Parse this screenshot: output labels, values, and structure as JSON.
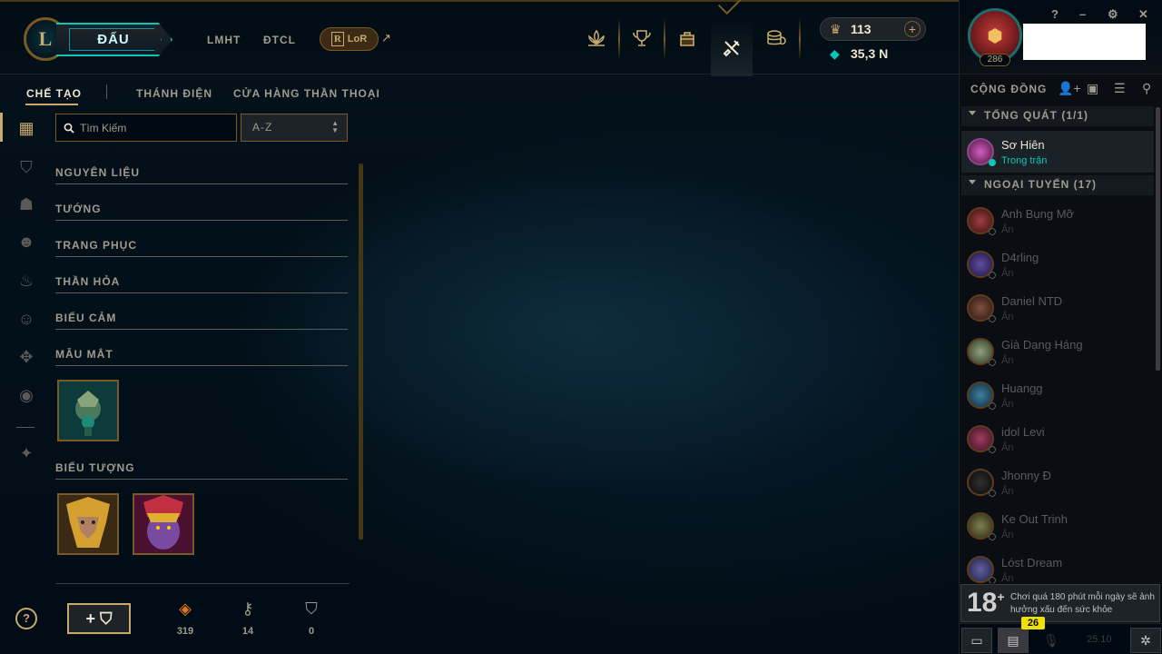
{
  "header": {
    "play_label": "ĐẤU",
    "nav": [
      "LMHT",
      "ĐTCL"
    ],
    "lor_label": "LoR",
    "lor_mark": "R",
    "ext_arrow": "↗",
    "top_icons": [
      "lotus-icon",
      "trophy-icon",
      "backpack-icon",
      "crafting-icon",
      "store-icon"
    ],
    "rp_value": "113",
    "be_value": "35,3 N",
    "plus": "+"
  },
  "profile": {
    "level": "286",
    "window_controls": [
      "?",
      "–",
      "⚙",
      "✕"
    ]
  },
  "subnav": {
    "tabs": [
      "CHẾ TẠO",
      "THÁNH ĐIỆN",
      "CỬA HÀNG THẦN THOẠI"
    ],
    "active": "CHẾ TẠO"
  },
  "search": {
    "placeholder": "Tìm Kiếm"
  },
  "sort": {
    "value": "A-Z"
  },
  "categories": [
    "NGUYÊN LIỆU",
    "TƯỚNG",
    "TRANG PHỤC",
    "THẦN HỎA",
    "BIỂU CẢM",
    "MẪU MẮT",
    "BIỂU TƯỢNG"
  ],
  "crafting": {
    "craft_label": "+",
    "resources": [
      {
        "icon": "orange-essence-icon",
        "value": "319"
      },
      {
        "icon": "key-fragment-icon",
        "value": "14"
      },
      {
        "icon": "chest-icon",
        "value": "0"
      }
    ]
  },
  "social": {
    "title": "CỘNG ĐỒNG",
    "groups": [
      {
        "label": "TỔNG QUÁT (1/1)"
      },
      {
        "label": "NGOẠI TUYẾN (17)"
      }
    ],
    "online_friends": [
      {
        "name": "Sơ Hiên",
        "status": "Trong trận"
      }
    ],
    "offline_friends": [
      {
        "name": "Anh Bụng Mỡ",
        "status": "Ẩn"
      },
      {
        "name": "D4rling",
        "status": "Ẩn"
      },
      {
        "name": "Daniel NTD",
        "status": "Ẩn"
      },
      {
        "name": "Già Dạng Háng",
        "status": "Ẩn"
      },
      {
        "name": "Huangg",
        "status": "Ẩn"
      },
      {
        "name": "idol Levi",
        "status": "Ẩn"
      },
      {
        "name": "Jhonny Đ",
        "status": "Ẩn"
      },
      {
        "name": "Ke Out Trinh",
        "status": "Ẩn"
      },
      {
        "name": "Lóst Dream",
        "status": "Ẩn"
      }
    ],
    "age_rating": "18",
    "age_plus": "+",
    "warning": "Chơi quá 180 phút mỗi ngày sẽ ảnh hưởng xấu đến sức khỏe",
    "notification_count": "26",
    "version": "25.10"
  },
  "colors": {
    "gold": "#c8aa6e",
    "teal": "#0ac8b9",
    "background": "#010a13"
  }
}
